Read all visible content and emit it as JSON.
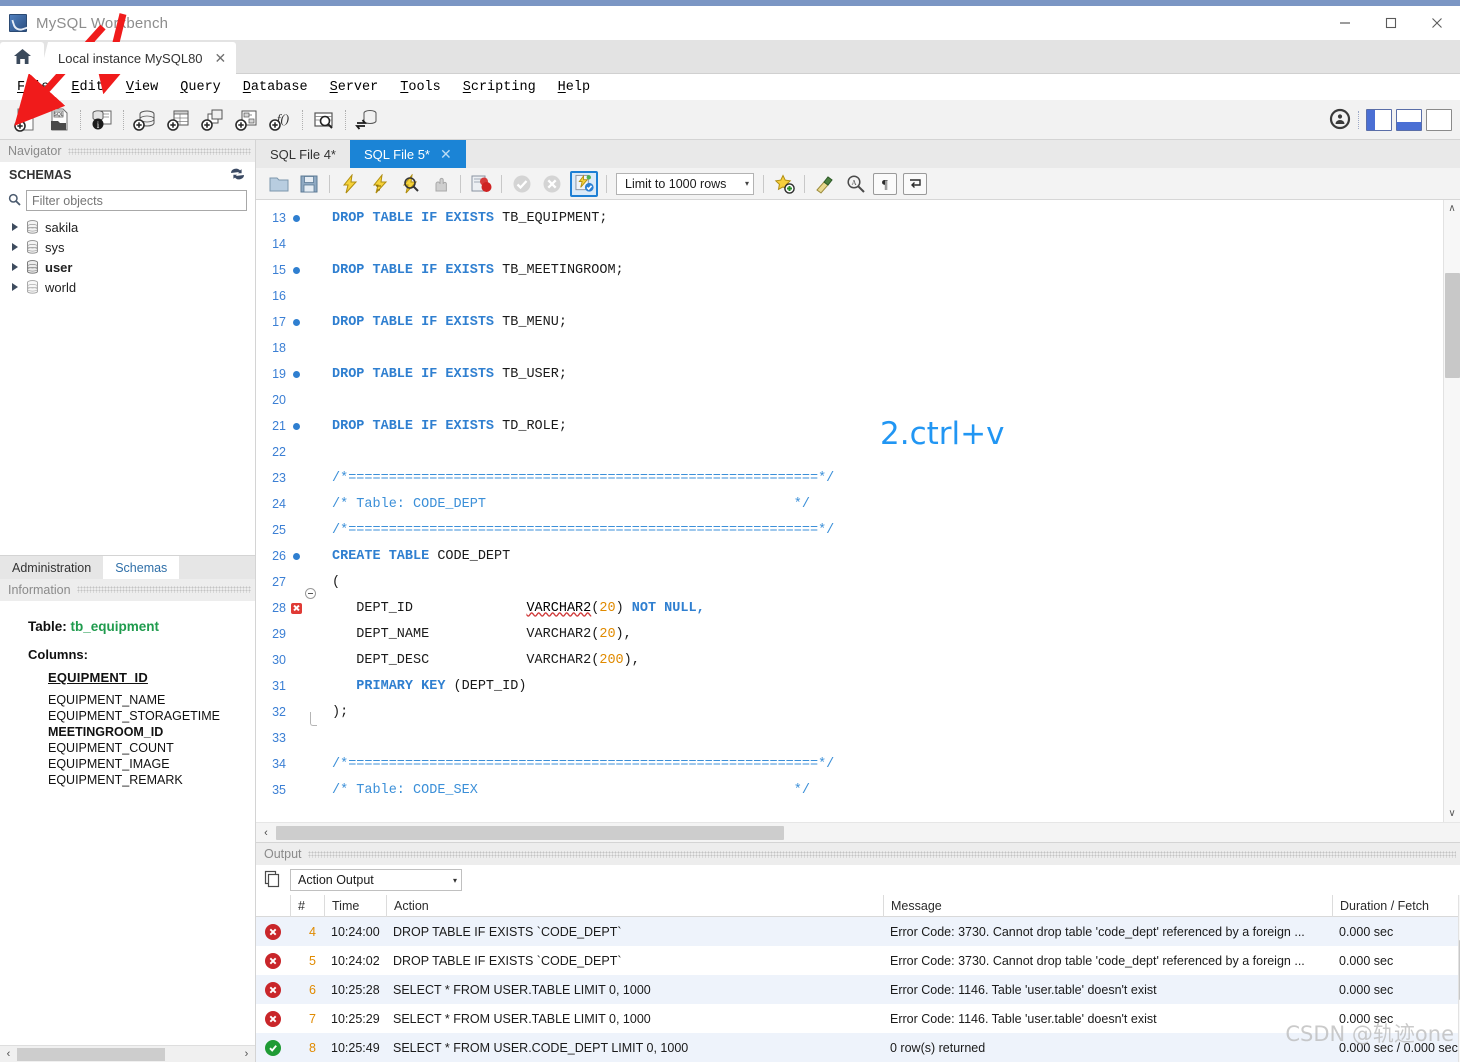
{
  "window": {
    "app_title": "MySQL Workbench",
    "logo_icon": "mysql-dolphin-icon",
    "minimize_label": "—",
    "maximize_label": "□",
    "close_label": "✕"
  },
  "connection_tabs": {
    "home_icon": "home-icon",
    "tabs": [
      {
        "label": "Local instance MySQL80",
        "close": "✕",
        "active": true
      }
    ]
  },
  "menubar": {
    "items": [
      {
        "pre": "",
        "hot": "F",
        "post": "ile"
      },
      {
        "pre": "",
        "hot": "E",
        "post": "dit"
      },
      {
        "pre": "",
        "hot": "V",
        "post": "iew"
      },
      {
        "pre": "",
        "hot": "Q",
        "post": "uery"
      },
      {
        "pre": "",
        "hot": "D",
        "post": "atabase"
      },
      {
        "pre": "",
        "hot": "S",
        "post": "erver"
      },
      {
        "pre": "",
        "hot": "T",
        "post": "ools"
      },
      {
        "pre": "",
        "hot": "S",
        "post": "cripting"
      },
      {
        "pre": "",
        "hot": "H",
        "post": "elp"
      }
    ]
  },
  "main_toolbar": {
    "icons": [
      "new-sql-tab-icon",
      "open-sql-script-icon",
      "connection-info-icon",
      "new-schema-icon",
      "new-table-icon",
      "new-view-icon",
      "new-stored-procedure-icon",
      "new-function-icon",
      "search-data-icon",
      "reconnect-server-icon"
    ],
    "right_icons": [
      "toggle-secondary-sidebar-icon",
      "toggle-sidebar-layout-icon",
      "toggle-output-layout-icon",
      "toggle-panel-layout-icon"
    ]
  },
  "sidebar": {
    "navigator_title": "Navigator",
    "schemas_title": "SCHEMAS",
    "refresh_icon": "refresh-icon",
    "search_icon": "search-icon",
    "filter_placeholder": "Filter objects",
    "filter_value": "",
    "schemas": [
      {
        "name": "sakila",
        "bold": false
      },
      {
        "name": "sys",
        "bold": false
      },
      {
        "name": "user",
        "bold": true
      },
      {
        "name": "world",
        "bold": false
      }
    ],
    "lower_tabs": [
      {
        "label": "Administration",
        "active": false
      },
      {
        "label": "Schemas",
        "active": true
      }
    ],
    "information_title": "Information",
    "info": {
      "table_label": "Table:",
      "table_name": "tb_equipment",
      "columns_label": "Columns:",
      "primary_key": "EQUIPMENT_ID",
      "columns": [
        {
          "name": "EQUIPMENT_NAME",
          "bold": false
        },
        {
          "name": "EQUIPMENT_STORAGETIME",
          "bold": false
        },
        {
          "name": "MEETINGROOM_ID",
          "bold": true
        },
        {
          "name": "EQUIPMENT_COUNT",
          "bold": false
        },
        {
          "name": "EQUIPMENT_IMAGE",
          "bold": false
        },
        {
          "name": "EQUIPMENT_REMARK",
          "bold": false
        }
      ]
    },
    "hscroll_left": "‹",
    "hscroll_right": "›"
  },
  "editor": {
    "tabs": [
      {
        "label": "SQL File 4*",
        "active": false,
        "close": ""
      },
      {
        "label": "SQL File 5*",
        "active": true,
        "close": "✕"
      }
    ],
    "toolbar_icons": [
      "open-script-icon",
      "save-script-icon",
      "execute-all-icon",
      "execute-current-statement-icon",
      "explain-query-icon",
      "stop-execution-icon",
      "toggle-stop-on-error-icon",
      "commit-icon",
      "rollback-icon",
      "toggle-autocommit-icon",
      "add-snippet-icon",
      "beautify-query-icon",
      "find-icon",
      "toggle-invisible-characters-icon",
      "toggle-wrapping-icon"
    ],
    "limit_label": "Limit to 1000 rows",
    "limit_caret": "▾",
    "annotation": "2.ctrl+v",
    "hscroll_left": "‹",
    "vscroll_up": "∧",
    "vscroll_down": "∨",
    "code_lines": [
      {
        "n": "13",
        "marker": "dot",
        "fold": "",
        "tokens": [
          {
            "t": "DROP TABLE IF EXISTS ",
            "c": "kw"
          },
          {
            "t": "TB_EQUIPMENT;",
            "c": "id"
          }
        ]
      },
      {
        "n": "14",
        "marker": "",
        "fold": "",
        "tokens": []
      },
      {
        "n": "15",
        "marker": "dot",
        "fold": "",
        "tokens": [
          {
            "t": "DROP TABLE IF EXISTS ",
            "c": "kw"
          },
          {
            "t": "TB_MEETINGROOM;",
            "c": "id"
          }
        ]
      },
      {
        "n": "16",
        "marker": "",
        "fold": "",
        "tokens": []
      },
      {
        "n": "17",
        "marker": "dot",
        "fold": "",
        "tokens": [
          {
            "t": "DROP TABLE IF EXISTS ",
            "c": "kw"
          },
          {
            "t": "TB_MENU;",
            "c": "id"
          }
        ]
      },
      {
        "n": "18",
        "marker": "",
        "fold": "",
        "tokens": []
      },
      {
        "n": "19",
        "marker": "dot",
        "fold": "",
        "tokens": [
          {
            "t": "DROP TABLE IF EXISTS ",
            "c": "kw"
          },
          {
            "t": "TB_USER;",
            "c": "id"
          }
        ]
      },
      {
        "n": "20",
        "marker": "",
        "fold": "",
        "tokens": []
      },
      {
        "n": "21",
        "marker": "dot",
        "fold": "",
        "tokens": [
          {
            "t": "DROP TABLE IF EXISTS ",
            "c": "kw"
          },
          {
            "t": "TD_ROLE;",
            "c": "id"
          }
        ]
      },
      {
        "n": "22",
        "marker": "",
        "fold": "",
        "tokens": []
      },
      {
        "n": "23",
        "marker": "",
        "fold": "",
        "tokens": [
          {
            "t": "/*==========================================================*/",
            "c": "cmt"
          }
        ]
      },
      {
        "n": "24",
        "marker": "",
        "fold": "",
        "tokens": [
          {
            "t": "/* Table: CODE_DEPT                                      */",
            "c": "cmt"
          }
        ]
      },
      {
        "n": "25",
        "marker": "",
        "fold": "",
        "tokens": [
          {
            "t": "/*==========================================================*/",
            "c": "cmt"
          }
        ]
      },
      {
        "n": "26",
        "marker": "dot",
        "fold": "",
        "tokens": [
          {
            "t": "CREATE TABLE ",
            "c": "kw"
          },
          {
            "t": "CODE_DEPT",
            "c": "id"
          }
        ]
      },
      {
        "n": "27",
        "marker": "",
        "fold": "start",
        "tokens": [
          {
            "t": "(",
            "c": "id"
          }
        ]
      },
      {
        "n": "28",
        "marker": "err",
        "fold": "mid",
        "tokens": [
          {
            "t": "   DEPT_ID              ",
            "c": "id"
          },
          {
            "t": "VARCHAR2",
            "c": "sq"
          },
          {
            "t": "(",
            "c": "id"
          },
          {
            "t": "20",
            "c": "num"
          },
          {
            "t": ") ",
            "c": "id"
          },
          {
            "t": "NOT NULL,",
            "c": "kw"
          }
        ]
      },
      {
        "n": "29",
        "marker": "",
        "fold": "mid",
        "tokens": [
          {
            "t": "   DEPT_NAME            VARCHAR2(",
            "c": "id"
          },
          {
            "t": "20",
            "c": "num"
          },
          {
            "t": "),",
            "c": "id"
          }
        ]
      },
      {
        "n": "30",
        "marker": "",
        "fold": "mid",
        "tokens": [
          {
            "t": "   DEPT_DESC            VARCHAR2(",
            "c": "id"
          },
          {
            "t": "200",
            "c": "num"
          },
          {
            "t": "),",
            "c": "id"
          }
        ]
      },
      {
        "n": "31",
        "marker": "",
        "fold": "mid",
        "tokens": [
          {
            "t": "   PRIMARY KEY ",
            "c": "kw"
          },
          {
            "t": "(DEPT_ID)",
            "c": "id"
          }
        ]
      },
      {
        "n": "32",
        "marker": "",
        "fold": "end",
        "tokens": [
          {
            "t": ");",
            "c": "id"
          }
        ]
      },
      {
        "n": "33",
        "marker": "",
        "fold": "",
        "tokens": []
      },
      {
        "n": "34",
        "marker": "",
        "fold": "",
        "tokens": [
          {
            "t": "/*==========================================================*/",
            "c": "cmt"
          }
        ]
      },
      {
        "n": "35",
        "marker": "",
        "fold": "",
        "tokens": [
          {
            "t": "/* Table: CODE_SEX                                       */",
            "c": "cmt"
          }
        ]
      }
    ]
  },
  "output": {
    "panel_title": "Output",
    "copy_icon": "copy-icon",
    "selected_view": "Action Output",
    "view_caret": "▾",
    "columns": [
      "",
      "#",
      "Time",
      "Action",
      "Message",
      "Duration / Fetch"
    ],
    "rows": [
      {
        "status": "error",
        "n": "4",
        "time": "10:24:00",
        "action": "DROP TABLE IF EXISTS `CODE_DEPT`",
        "message": "Error Code: 3730. Cannot drop table 'code_dept' referenced by a foreign ...",
        "duration": "0.000 sec"
      },
      {
        "status": "error",
        "n": "5",
        "time": "10:24:02",
        "action": "DROP TABLE IF EXISTS `CODE_DEPT`",
        "message": "Error Code: 3730. Cannot drop table 'code_dept' referenced by a foreign ...",
        "duration": "0.000 sec"
      },
      {
        "status": "error",
        "n": "6",
        "time": "10:25:28",
        "action": "SELECT * FROM USER.TABLE LIMIT 0, 1000",
        "message": "Error Code: 1146. Table 'user.table' doesn't exist",
        "duration": "0.000 sec"
      },
      {
        "status": "error",
        "n": "7",
        "time": "10:25:29",
        "action": "SELECT * FROM USER.TABLE LIMIT 0, 1000",
        "message": "Error Code: 1146. Table 'user.table' doesn't exist",
        "duration": "0.000 sec"
      },
      {
        "status": "success",
        "n": "8",
        "time": "10:25:49",
        "action": "SELECT * FROM USER.CODE_DEPT LIMIT 0, 1000",
        "message": "0 row(s) returned",
        "duration": "0.000 sec / 0.000 sec"
      }
    ]
  },
  "watermark": {
    "text": "CSDN @轨迹one"
  },
  "colors": {
    "accent": "#1b84d6",
    "keyword": "#2f7fd0",
    "comment": "#3b8fd8",
    "number": "#e08a00",
    "error": "#c9262a",
    "success": "#1f9b35",
    "annotation": "#2196f3",
    "arrow": "#f01b1b"
  }
}
